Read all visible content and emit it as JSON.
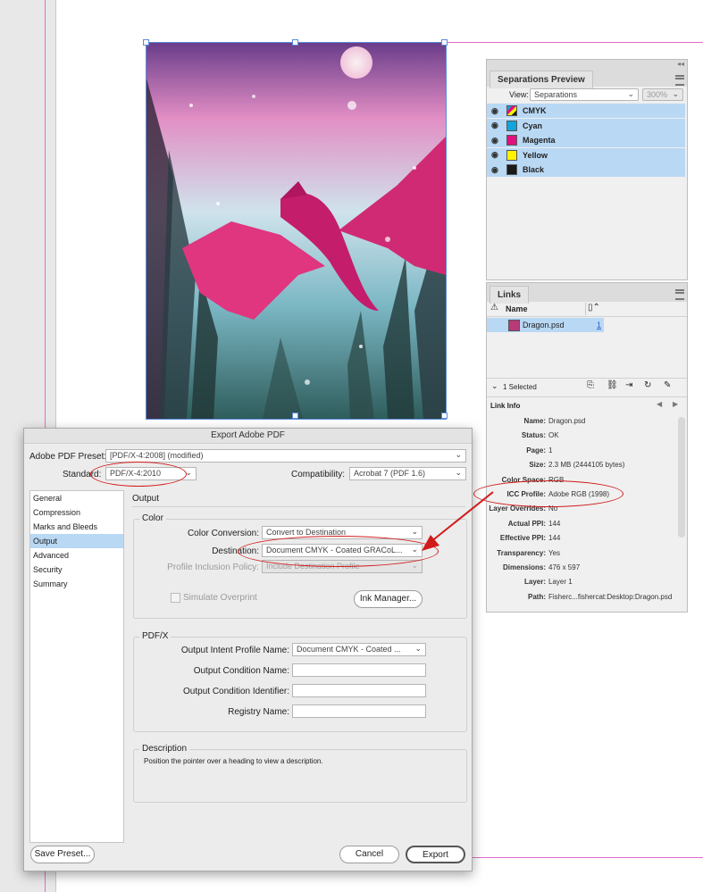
{
  "separations": {
    "tab_label": "Separations Preview",
    "view_label": "View:",
    "view_value": "Separations",
    "zoom_value": "300%",
    "rows": [
      {
        "label": "CMYK",
        "color": "#ffffff"
      },
      {
        "label": "Cyan",
        "color": "#12a4dc"
      },
      {
        "label": "Magenta",
        "color": "#e0117f"
      },
      {
        "label": "Yellow",
        "color": "#fff200"
      },
      {
        "label": "Black",
        "color": "#1a1a1a"
      }
    ]
  },
  "links": {
    "tab_label": "Links",
    "col_name": "Name",
    "file_name": "Dragon.psd",
    "page_num": "1",
    "selected_status": "1 Selected",
    "link_info_label": "Link Info",
    "info": [
      {
        "key": "Name:",
        "value": "Dragon.psd"
      },
      {
        "key": "Status:",
        "value": "OK"
      },
      {
        "key": "Page:",
        "value": "1"
      },
      {
        "key": "Size:",
        "value": "2.3 MB (2444105 bytes)"
      },
      {
        "key": "Color Space:",
        "value": "RGB"
      },
      {
        "key": "ICC Profile:",
        "value": "Adobe RGB (1998)"
      },
      {
        "key": "Layer Overrides:",
        "value": "No"
      },
      {
        "key": "Actual PPI:",
        "value": "144"
      },
      {
        "key": "Effective PPI:",
        "value": "144"
      },
      {
        "key": "Transparency:",
        "value": "Yes"
      },
      {
        "key": "Dimensions:",
        "value": "476 x 597"
      },
      {
        "key": "Layer:",
        "value": "Layer 1"
      },
      {
        "key": "Path:",
        "value": "Fisherc...fishercat:Desktop:Dragon.psd"
      }
    ]
  },
  "dialog": {
    "title": "Export Adobe PDF",
    "preset_label": "Adobe PDF Preset:",
    "preset_value": "[PDF/X-4:2008] (modified)",
    "standard_label": "Standard:",
    "standard_value": "PDF/X-4:2010",
    "compat_label": "Compatibility:",
    "compat_value": "Acrobat 7 (PDF 1.6)",
    "sidebar": [
      "General",
      "Compression",
      "Marks and Bleeds",
      "Output",
      "Advanced",
      "Security",
      "Summary"
    ],
    "section_title": "Output",
    "color_group": "Color",
    "color_conversion_label": "Color Conversion:",
    "color_conversion_value": "Convert to Destination",
    "destination_label": "Destination:",
    "destination_value": "Document CMYK - Coated GRACoL...",
    "profile_policy_label": "Profile Inclusion Policy:",
    "profile_policy_value": "Include Destination Profile",
    "simulate_overprint": "Simulate Overprint",
    "ink_manager": "Ink Manager...",
    "pdfx_group": "PDF/X",
    "output_intent_label": "Output Intent Profile Name:",
    "output_intent_value": "Document CMYK - Coated ...",
    "output_condition_name_label": "Output Condition Name:",
    "output_condition_id_label": "Output Condition Identifier:",
    "registry_name_label": "Registry Name:",
    "description_group": "Description",
    "description_text": "Position the pointer over a heading to view a description.",
    "save_preset": "Save Preset...",
    "cancel": "Cancel",
    "export": "Export"
  },
  "colors": {
    "selection_blue": "#b9d8f4",
    "annotation_red": "#d11a1a",
    "guide_magenta": "#e36bc9"
  }
}
